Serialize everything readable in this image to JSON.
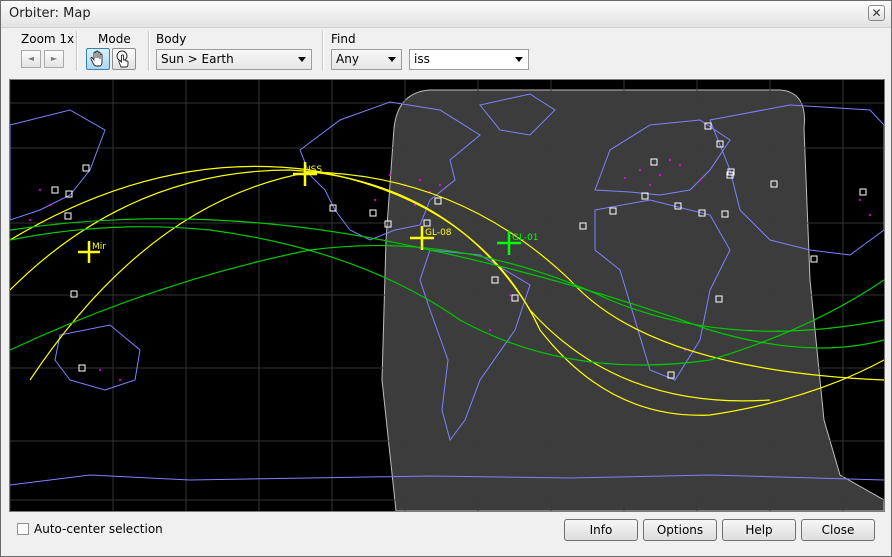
{
  "window": {
    "title": "Orbiter: Map"
  },
  "toolbar": {
    "zoom_label": "Zoom 1x",
    "mode_label": "Mode",
    "body_label": "Body",
    "body_value": "Sun > Earth",
    "find_label": "Find",
    "find_filter_value": "Any",
    "find_text_value": "iss"
  },
  "map": {
    "vessels": [
      {
        "label": "ISS",
        "color": "#ffff00"
      },
      {
        "label": "Mir",
        "color": "#ffff00"
      },
      {
        "label": "GL-08",
        "color": "#ffff00"
      },
      {
        "label": "GL-01",
        "color": "#00ff00"
      }
    ],
    "colors": {
      "coastline": "#8080ff",
      "grid": "#3a3a3a",
      "night": "#3a3a3a",
      "cities": "#ff00ff",
      "orbit_selected": "#ffff00",
      "orbit_other": "#00c800"
    }
  },
  "footer": {
    "autocenter_label": "Auto-center selection",
    "info_label": "Info",
    "options_label": "Options",
    "help_label": "Help",
    "close_label": "Close"
  }
}
